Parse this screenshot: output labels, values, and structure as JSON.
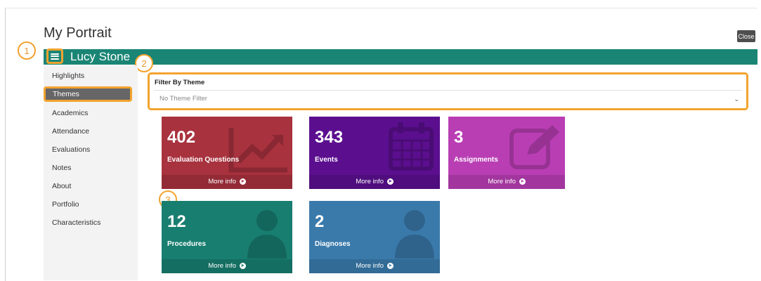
{
  "page": {
    "title": "My Portrait",
    "close_label": "Close"
  },
  "header": {
    "user_name": "Lucy Stone"
  },
  "sidebar": {
    "items": [
      {
        "label": "Highlights",
        "active": false
      },
      {
        "label": "Themes",
        "active": true
      },
      {
        "label": "Academics",
        "active": false
      },
      {
        "label": "Attendance",
        "active": false
      },
      {
        "label": "Evaluations",
        "active": false
      },
      {
        "label": "Notes",
        "active": false
      },
      {
        "label": "About",
        "active": false
      },
      {
        "label": "Portfolio",
        "active": false
      },
      {
        "label": "Characteristics",
        "active": false
      }
    ]
  },
  "filter": {
    "label": "Filter By Theme",
    "selected": "No Theme Filter"
  },
  "callouts": [
    "1",
    "2",
    "3"
  ],
  "tiles": [
    {
      "value": "402",
      "label": "Evaluation Questions",
      "more": "More info",
      "color": "#a8323e",
      "icon": "chart-line-icon"
    },
    {
      "value": "343",
      "label": "Events",
      "more": "More info",
      "color": "#5b0f8f",
      "icon": "calendar-icon"
    },
    {
      "value": "3",
      "label": "Assignments",
      "more": "More info",
      "color": "#b93eb4",
      "icon": "edit-icon"
    },
    {
      "value": "12",
      "label": "Procedures",
      "more": "More info",
      "color": "#187e70",
      "icon": "doctor-icon"
    },
    {
      "value": "2",
      "label": "Diagnoses",
      "more": "More info",
      "color": "#3a7aab",
      "icon": "doctor-icon"
    }
  ],
  "colors": {
    "header": "#1a8574",
    "highlight": "#f2a32f",
    "active_nav": "#666666"
  }
}
